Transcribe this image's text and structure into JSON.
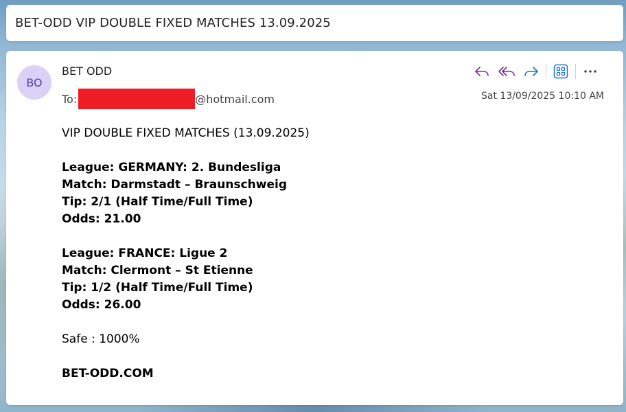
{
  "subject": "BET-ODD VIP DOUBLE FIXED MATCHES 13.09.2025",
  "sender": {
    "initials": "BO",
    "name": "BET ODD",
    "to_label": "To:",
    "to_domain": "@hotmail.com"
  },
  "date": "Sat 13/09/2025 10:10 AM",
  "toolbar": {
    "reply_icon": "reply-icon",
    "reply_all_icon": "reply-all-icon",
    "forward_icon": "forward-icon",
    "apps_icon": "apps-icon",
    "more_icon": "more-icon"
  },
  "body": {
    "intro": "VIP DOUBLE FIXED MATCHES (13.09.2025)",
    "matches": [
      {
        "league": "League: GERMANY: 2. Bundesliga",
        "match": "Match: Darmstadt – Braunschweig",
        "tip": "Tip: 2/1 (Half Time/Full Time)",
        "odds": "Odds: 21.00"
      },
      {
        "league": "League: FRANCE: Ligue 2",
        "match": "Match: Clermont – St Etienne",
        "tip": "Tip: 1/2 (Half Time/Full Time)",
        "odds": "Odds: 26.00"
      }
    ],
    "safe": "Safe : 1000%",
    "footer": "BET-ODD.COM"
  },
  "colors": {
    "reply_icon": "#7a2f8e",
    "forward_icon": "#1a73c8",
    "apps_icon": "#1a73c8",
    "avatar_bg": "#d9d2f6",
    "redaction": "#ee1c25"
  }
}
